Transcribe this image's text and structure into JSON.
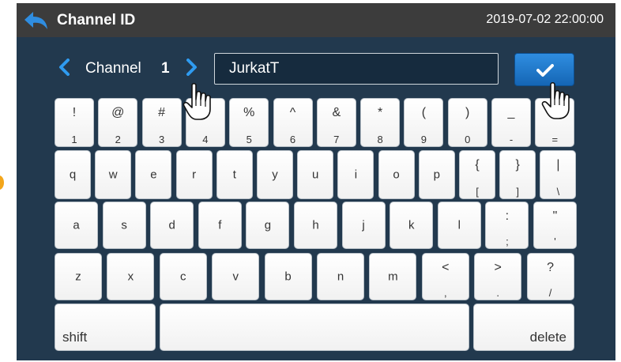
{
  "header": {
    "title": "Channel ID",
    "datetime": "2019-07-02  22:00:00"
  },
  "channel": {
    "label": "Channel",
    "number": "1"
  },
  "name_input": {
    "value": "JurkatT"
  },
  "keyboard": {
    "row1": [
      {
        "top": "!",
        "bottom": "1"
      },
      {
        "top": "@",
        "bottom": "2"
      },
      {
        "top": "#",
        "bottom": "3"
      },
      {
        "top": "$",
        "bottom": "4"
      },
      {
        "top": "%",
        "bottom": "5"
      },
      {
        "top": "^",
        "bottom": "6"
      },
      {
        "top": "&",
        "bottom": "7"
      },
      {
        "top": "*",
        "bottom": "8"
      },
      {
        "top": "(",
        "bottom": "9"
      },
      {
        "top": ")",
        "bottom": "0"
      },
      {
        "top": "_",
        "bottom": "-"
      },
      {
        "top": "+",
        "bottom": "="
      }
    ],
    "row2": [
      {
        "label": "q"
      },
      {
        "label": "w"
      },
      {
        "label": "e"
      },
      {
        "label": "r"
      },
      {
        "label": "t"
      },
      {
        "label": "y"
      },
      {
        "label": "u"
      },
      {
        "label": "i"
      },
      {
        "label": "o"
      },
      {
        "label": "p"
      },
      {
        "top": "{",
        "bottom": "["
      },
      {
        "top": "}",
        "bottom": "]"
      },
      {
        "top": "|",
        "bottom": "\\"
      }
    ],
    "row3": [
      {
        "label": "a"
      },
      {
        "label": "s"
      },
      {
        "label": "d"
      },
      {
        "label": "f"
      },
      {
        "label": "g"
      },
      {
        "label": "h"
      },
      {
        "label": "j"
      },
      {
        "label": "k"
      },
      {
        "label": "l"
      },
      {
        "top": ":",
        "bottom": ";"
      },
      {
        "top": "\"",
        "bottom": "'"
      }
    ],
    "row4": [
      {
        "label": "z"
      },
      {
        "label": "x"
      },
      {
        "label": "c"
      },
      {
        "label": "v"
      },
      {
        "label": "b"
      },
      {
        "label": "n"
      },
      {
        "label": "m"
      },
      {
        "top": "<",
        "bottom": ","
      },
      {
        "top": ">",
        "bottom": "."
      },
      {
        "top": "?",
        "bottom": "/"
      }
    ],
    "shift_label": "shift",
    "delete_label": "delete"
  },
  "colors": {
    "titlebar": "#3c3c3c",
    "background": "#22394e",
    "accent": "#2f8de0"
  },
  "icons": {
    "back": "back-arrow-icon",
    "prev": "chevron-left-icon",
    "next": "chevron-right-icon",
    "confirm": "checkmark-icon",
    "pointer": "hand-pointer-icon"
  }
}
